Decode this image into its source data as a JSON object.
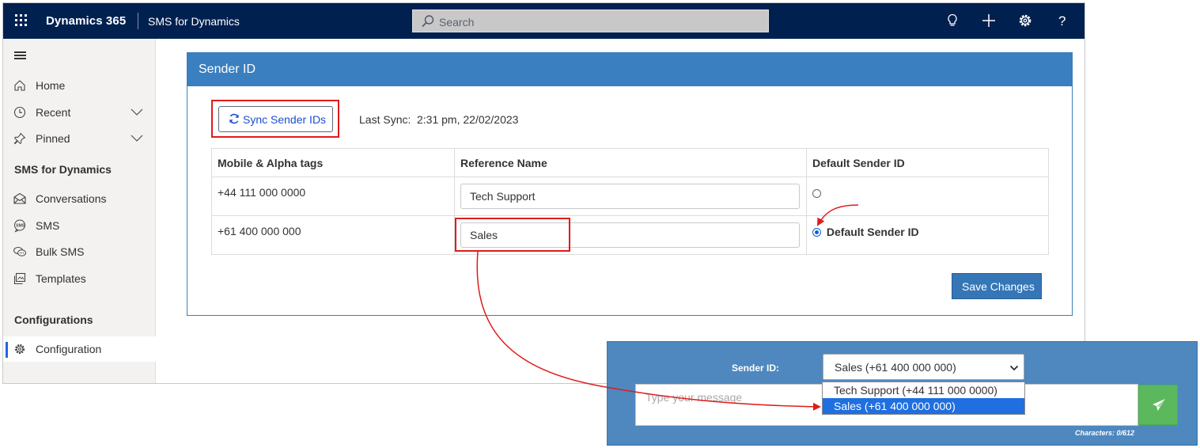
{
  "topbar": {
    "brand": "Dynamics 365",
    "app_name": "SMS for Dynamics",
    "search_placeholder": "Search",
    "icons": [
      "lightbulb-icon",
      "plus-icon",
      "gear-icon",
      "help-icon"
    ]
  },
  "sidebar": {
    "items": [
      {
        "label": "Home",
        "icon": "home-icon"
      },
      {
        "label": "Recent",
        "icon": "clock-icon"
      },
      {
        "label": "Pinned",
        "icon": "pin-icon"
      }
    ],
    "section_sms": "SMS for Dynamics",
    "sms_items": [
      {
        "label": "Conversations",
        "icon": "envelope-icon"
      },
      {
        "label": "SMS",
        "icon": "sms-icon"
      },
      {
        "label": "Bulk SMS",
        "icon": "chat-bubbles-icon"
      },
      {
        "label": "Templates",
        "icon": "templates-icon"
      }
    ],
    "section_config": "Configurations",
    "config_item": {
      "label": "Configuration",
      "icon": "gear-icon"
    }
  },
  "panel": {
    "title": "Sender ID",
    "sync_button": "Sync Sender IDs",
    "last_sync_label": "Last Sync:",
    "last_sync_value": "2:31 pm, 22/02/2023",
    "columns": [
      "Mobile & Alpha tags",
      "Reference Name",
      "Default Sender ID"
    ],
    "rows": [
      {
        "tag": "+44 111 000 0000",
        "reference": "Tech Support",
        "default": false,
        "default_label": ""
      },
      {
        "tag": "+61 400 000 000",
        "reference": "Sales",
        "default": true,
        "default_label": "Default Sender ID"
      }
    ],
    "save_button": "Save Changes"
  },
  "composer": {
    "sender_label": "Sender ID:",
    "selected": "Sales (+61 400 000 000)",
    "options": [
      "Tech Support (+44 111 000 0000)",
      "Sales (+61 400 000 000)"
    ],
    "selected_index": 1,
    "message_placeholder": "Type your message",
    "characters": "Characters: 0/612"
  },
  "colors": {
    "topbar": "#002050",
    "panel_header": "#3a7fbf",
    "highlight": "#e01b1b",
    "composer_bg": "#4e88bf",
    "send_button": "#5cb85c"
  }
}
